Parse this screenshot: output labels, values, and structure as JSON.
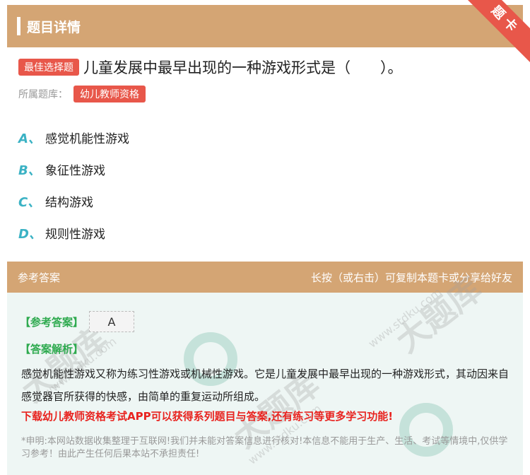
{
  "header": {
    "title": "题目详情",
    "corner": "题卡"
  },
  "question": {
    "type_tag": "最佳选择题",
    "text": "儿童发展中最早出现的一种游戏形式是（　　）。",
    "bank_label": "所属题库：",
    "bank_tag": "幼儿教师资格"
  },
  "options": [
    {
      "letter": "A、",
      "text": "感觉机能性游戏"
    },
    {
      "letter": "B、",
      "text": "象征性游戏"
    },
    {
      "letter": "C、",
      "text": "结构游戏"
    },
    {
      "letter": "D、",
      "text": "规则性游戏"
    }
  ],
  "answer": {
    "header_left": "参考答案",
    "header_right": "长按（或右击）可复制本题卡或分享给好友",
    "answer_label": "【参考答案】",
    "answer_value": "A",
    "analysis_label": "【答案解析】",
    "analysis_text": "感觉机能性游戏又称为练习性游戏或机械性游戏。它是儿童发展中最早出现的一种游戏形式，其动因来自感觉器官所获得的快感，由简单的重复运动所组成。",
    "promo": "下载幼儿教师资格考试APP可以获得系列题目与答案,还有练习等更多学习功能!",
    "disclaimer": "*申明:本网站数据收集整理于互联网!我们并未能对答案信息进行核对!本信息不能用于生产、生活、考试等情境中,仅供学习参考！由此产生任何后果本站不承担责任!"
  },
  "watermark": {
    "text": "大题库",
    "url": "www.stdku.com"
  },
  "colors": {
    "header_bg": "#d4a574",
    "tag_red": "#e8574a",
    "option_letter": "#3bb2c4",
    "answer_green": "#2eaa4f",
    "promo_red": "#e8231f"
  }
}
